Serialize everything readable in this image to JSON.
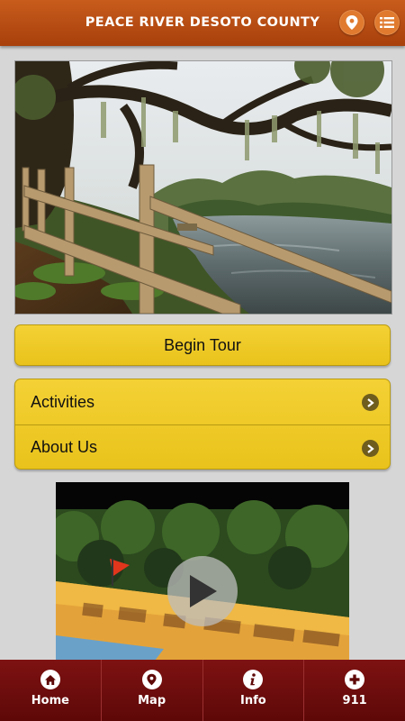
{
  "header": {
    "title": "PEACE RIVER DESOTO COUNTY",
    "location_icon": "location-pin-icon",
    "menu_icon": "list-menu-icon"
  },
  "hero": {
    "description": "",
    "icon": "photo"
  },
  "begin_tour": {
    "label": "Begin Tour"
  },
  "menu_list": {
    "items": [
      {
        "label": "Activities",
        "icon": "chevron-right-icon"
      },
      {
        "label": "About Us",
        "icon": "chevron-right-icon"
      }
    ]
  },
  "video": {
    "play_icon": "play-icon"
  },
  "bottom_nav": {
    "items": [
      {
        "label": "Home",
        "icon": "home-icon"
      },
      {
        "label": "Map",
        "icon": "map-pin-icon"
      },
      {
        "label": "Info",
        "icon": "info-icon"
      },
      {
        "label": "911",
        "icon": "plus-icon"
      }
    ]
  },
  "colors": {
    "header": "#b34a12",
    "button_yellow": "#f0cb25",
    "nav": "#6e0d0d",
    "background": "#d6d6d6"
  }
}
